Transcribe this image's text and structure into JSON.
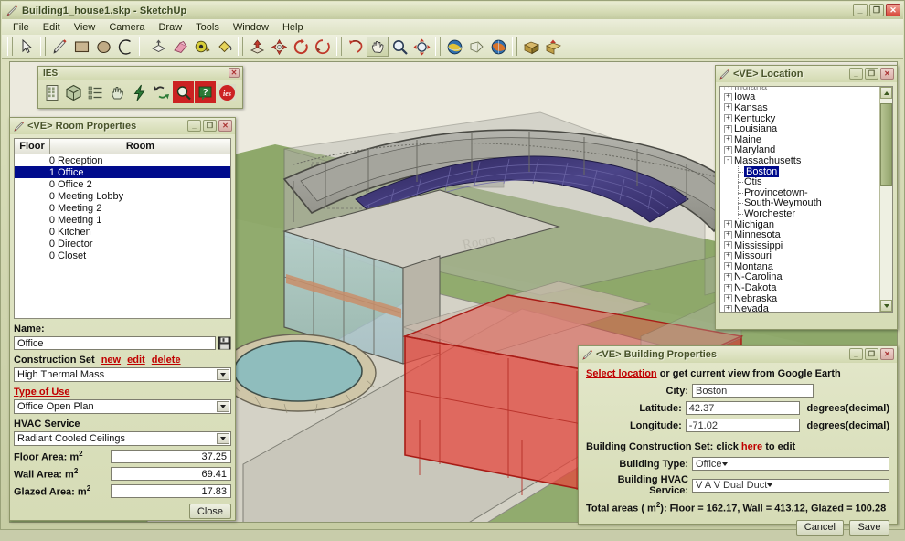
{
  "window": {
    "title": "Building1_house1.skp - SketchUp",
    "icon": "sketchup-pencil-icon",
    "controls": {
      "minimize": "_",
      "maximize": "❐",
      "close": "✕"
    }
  },
  "menubar": {
    "items": [
      {
        "label": "File"
      },
      {
        "label": "Edit"
      },
      {
        "label": "View"
      },
      {
        "label": "Camera"
      },
      {
        "label": "Draw"
      },
      {
        "label": "Tools"
      },
      {
        "label": "Window"
      },
      {
        "label": "Help"
      }
    ]
  },
  "toolbar": {
    "tools": [
      {
        "name": "select-arrow-tool",
        "title": "Select"
      },
      {
        "name": "pencil-line-tool",
        "title": "Line"
      },
      {
        "name": "rectangle-tool",
        "title": "Rectangle"
      },
      {
        "name": "circle-tool",
        "title": "Circle"
      },
      {
        "name": "arc-tool",
        "title": "Arc"
      },
      {
        "name": "pushpull-tool",
        "title": "Push/Pull"
      },
      {
        "name": "eraser-tool",
        "title": "Eraser"
      },
      {
        "name": "tape-measure-tool",
        "title": "Tape Measure"
      },
      {
        "name": "paint-bucket-tool",
        "title": "Paint Bucket"
      },
      {
        "name": "move-tool",
        "title": "Move"
      },
      {
        "name": "scale-tool",
        "title": "Scale"
      },
      {
        "name": "rotate-tool",
        "title": "Rotate"
      },
      {
        "name": "follow-me-tool",
        "title": "Follow Me"
      },
      {
        "name": "offset-tool",
        "title": "Offset"
      },
      {
        "name": "pan-hand-tool",
        "title": "Pan"
      },
      {
        "name": "zoom-magnifier-tool",
        "title": "Zoom"
      },
      {
        "name": "zoom-extents-tool",
        "title": "Zoom Extents"
      },
      {
        "name": "orbit-globe-tool",
        "title": "Orbit"
      },
      {
        "name": "position-camera-tool",
        "title": "Position Camera"
      },
      {
        "name": "google-earth-tool",
        "title": "Google Earth"
      },
      {
        "name": "get-models-tool",
        "title": "Get Models"
      },
      {
        "name": "share-model-tool",
        "title": "Share Model"
      }
    ]
  },
  "ies_toolbar": {
    "title": "IES",
    "close_label": "✕",
    "buttons": [
      {
        "name": "grid-building-icon"
      },
      {
        "name": "cube-model-icon"
      },
      {
        "name": "list-properties-icon"
      },
      {
        "name": "hand-pointer-icon"
      },
      {
        "name": "lightning-energy-icon"
      },
      {
        "name": "refresh-sync-icon"
      },
      {
        "name": "search-results-icon"
      },
      {
        "name": "help-question-icon"
      },
      {
        "name": "ies-logo-icon"
      }
    ]
  },
  "room_properties": {
    "title": "<VE> Room Properties",
    "columns": {
      "floor": "Floor",
      "room": "Room"
    },
    "rows": [
      {
        "floor": "0",
        "room": "Reception",
        "selected": false
      },
      {
        "floor": "1",
        "room": "Office",
        "selected": true
      },
      {
        "floor": "0",
        "room": "Office 2",
        "selected": false
      },
      {
        "floor": "0",
        "room": "Meeting Lobby",
        "selected": false
      },
      {
        "floor": "0",
        "room": "Meeting 2",
        "selected": false
      },
      {
        "floor": "0",
        "room": "Meeting 1",
        "selected": false
      },
      {
        "floor": "0",
        "room": "Kitchen",
        "selected": false
      },
      {
        "floor": "0",
        "room": "Director",
        "selected": false
      },
      {
        "floor": "0",
        "room": "Closet",
        "selected": false
      }
    ],
    "name_label": "Name:",
    "name_value": "Office",
    "save_icon": "floppy-save-icon",
    "construction_set_label": "Construction Set",
    "construction_set_links": [
      {
        "label": "new"
      },
      {
        "label": "edit"
      },
      {
        "label": "delete"
      }
    ],
    "construction_set_value": "High Thermal Mass",
    "type_of_use_label": "Type of Use",
    "type_of_use_value": "Office Open Plan",
    "hvac_label": "HVAC Service",
    "hvac_value": "Radiant Cooled Ceilings",
    "areas": [
      {
        "label": "Floor Area: m",
        "sup": "2",
        "value": "37.25"
      },
      {
        "label": "Wall Area: m",
        "sup": "2",
        "value": "69.41"
      },
      {
        "label": "Glazed Area: m",
        "sup": "2",
        "value": "17.83"
      }
    ],
    "close_button": "Close"
  },
  "location": {
    "title": "<VE> Location",
    "tree": [
      {
        "label": "Indiana",
        "kind": "branch",
        "expander": "+",
        "indent": 0,
        "partial": true
      },
      {
        "label": "Iowa",
        "kind": "branch",
        "expander": "+",
        "indent": 0
      },
      {
        "label": "Kansas",
        "kind": "branch",
        "expander": "+",
        "indent": 0
      },
      {
        "label": "Kentucky",
        "kind": "branch",
        "expander": "+",
        "indent": 0
      },
      {
        "label": "Louisiana",
        "kind": "branch",
        "expander": "+",
        "indent": 0
      },
      {
        "label": "Maine",
        "kind": "branch",
        "expander": "+",
        "indent": 0
      },
      {
        "label": "Maryland",
        "kind": "branch",
        "expander": "+",
        "indent": 0
      },
      {
        "label": "Massachusetts",
        "kind": "branch",
        "expander": "-",
        "indent": 0
      },
      {
        "label": "Boston",
        "kind": "leaf",
        "indent": 1,
        "selected": true
      },
      {
        "label": "Otis",
        "kind": "leaf",
        "indent": 1
      },
      {
        "label": "Provincetown-",
        "kind": "leaf",
        "indent": 1
      },
      {
        "label": "South-Weymouth",
        "kind": "leaf",
        "indent": 1
      },
      {
        "label": "Worchester",
        "kind": "leaf",
        "indent": 1
      },
      {
        "label": "Michigan",
        "kind": "branch",
        "expander": "+",
        "indent": 0
      },
      {
        "label": "Minnesota",
        "kind": "branch",
        "expander": "+",
        "indent": 0
      },
      {
        "label": "Mississippi",
        "kind": "branch",
        "expander": "+",
        "indent": 0
      },
      {
        "label": "Missouri",
        "kind": "branch",
        "expander": "+",
        "indent": 0
      },
      {
        "label": "Montana",
        "kind": "branch",
        "expander": "+",
        "indent": 0
      },
      {
        "label": "N-Carolina",
        "kind": "branch",
        "expander": "+",
        "indent": 0
      },
      {
        "label": "N-Dakota",
        "kind": "branch",
        "expander": "+",
        "indent": 0
      },
      {
        "label": "Nebraska",
        "kind": "branch",
        "expander": "+",
        "indent": 0
      },
      {
        "label": "Nevada",
        "kind": "branch",
        "expander": "+",
        "indent": 0
      }
    ]
  },
  "building_properties": {
    "title": "<VE> Building Properties",
    "select_location_link": "Select location",
    "select_location_rest": " or get current view from Google Earth",
    "city_label": "City:",
    "city_value": "Boston",
    "latitude_label": "Latitude:",
    "latitude_value": "42.37",
    "longitude_label": "Longitude:",
    "longitude_value": "-71.02",
    "degrees_unit": "degrees(decimal)",
    "construction_prefix": "Building Construction Set: click ",
    "construction_link": "here",
    "construction_suffix": " to edit",
    "building_type_label": "Building Type:",
    "building_type_value": "Office",
    "building_hvac_label": "Building HVAC Service:",
    "building_hvac_value": "V A V Dual Duct",
    "totals_prefix": "Total areas ( m",
    "totals_sup": "2",
    "totals_text": "): Floor = 162.17, Wall = 413.12, Glazed = 100.28",
    "cancel_button": "Cancel",
    "save_button": "Save"
  },
  "colors": {
    "accent_red": "#c00000",
    "selection_blue": "#000b8c",
    "window_chrome": "#d6dcb6",
    "ground_green": "#8ea86a",
    "selected_room_red": "#e8453c",
    "solar_panel_purple": "#3b3570",
    "pool_water": "#8fbdbd"
  }
}
